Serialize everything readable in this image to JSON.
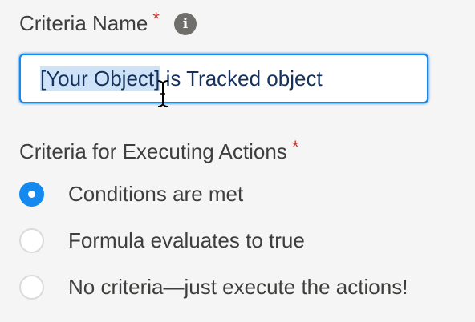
{
  "criteria_name": {
    "label": "Criteria Name",
    "required_mark": "*",
    "info_icon": "info-icon",
    "input_value_selected": "[Your Object]",
    "input_value_rest": " is Tracked object"
  },
  "criteria_actions": {
    "label": "Criteria for Executing Actions",
    "required_mark": "*",
    "options": [
      {
        "label": "Conditions are met",
        "selected": true
      },
      {
        "label": "Formula evaluates to true",
        "selected": false
      },
      {
        "label": "No criteria—just execute the actions!",
        "selected": false
      }
    ]
  },
  "colors": {
    "accent": "#1589ee",
    "required": "#c23934",
    "selection": "#cfe3f8",
    "text": "#3e3e3c"
  }
}
